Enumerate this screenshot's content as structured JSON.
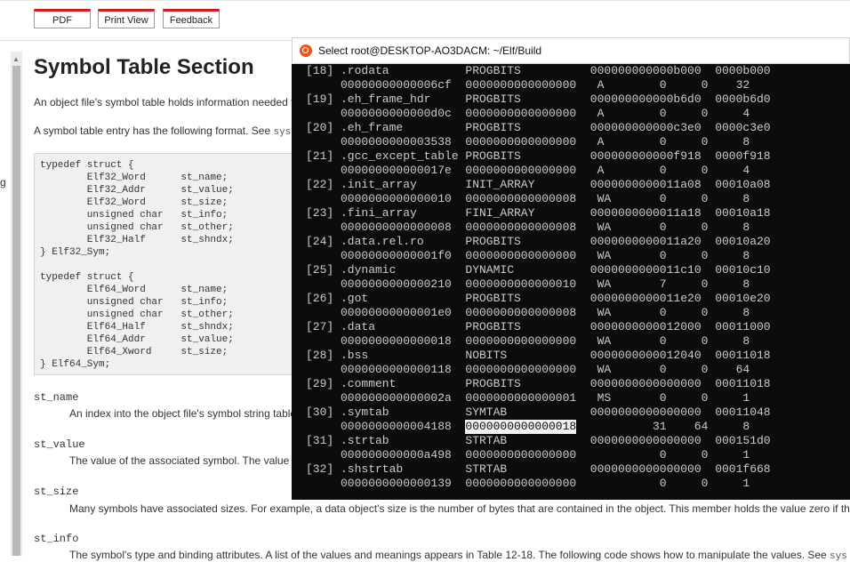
{
  "toolbar": {
    "pdf": "PDF",
    "print_view": "Print View",
    "feedback": "Feedback"
  },
  "left_mark": "g",
  "doc": {
    "title": "Symbol Table Section",
    "para1": "An object file's symbol table holds information needed t",
    "para2_prefix": "A symbol table entry has the following format. See ",
    "para2_code": "sys",
    "code32": "typedef struct {\n        Elf32_Word      st_name;\n        Elf32_Addr      st_value;\n        Elf32_Word      st_size;\n        unsigned char   st_info;\n        unsigned char   st_other;\n        Elf32_Half      st_shndx;\n} Elf32_Sym;",
    "code64": "typedef struct {\n        Elf64_Word      st_name;\n        unsigned char   st_info;\n        unsigned char   st_other;\n        Elf64_Half      st_shndx;\n        Elf64_Addr      st_value;\n        Elf64_Xword     st_size;\n} Elf64_Sym;",
    "terms": [
      {
        "name": "st_name",
        "desc": "An index into the object file's symbol string table"
      },
      {
        "name": "st_value",
        "desc": "The value of the associated symbol. The value"
      },
      {
        "name": "st_size",
        "desc": "Many symbols have associated sizes. For example, a data object's size is the number of bytes that are contained in the object. This member holds the value zero if th"
      },
      {
        "name": "st_info",
        "desc": "The symbol's type and binding attributes. A list of the values and meanings appears in Table 12-18. The following code shows how to manipulate the values. See ",
        "desc_code": "sys"
      }
    ]
  },
  "terminal": {
    "title": "Select root@DESKTOP-AO3DACM: ~/Elf/Build",
    "sections": [
      {
        "idx": "[18]",
        "name": ".rodata",
        "type": "PROGBITS",
        "addr": "000000000000b000",
        "off": "0000b000",
        "size": "00000000000006cf",
        "entsize": "0000000000000000",
        "flags": "A",
        "link": "0",
        "info": "0",
        "align": "32"
      },
      {
        "idx": "[19]",
        "name": ".eh_frame_hdr",
        "type": "PROGBITS",
        "addr": "000000000000b6d0",
        "off": "0000b6d0",
        "size": "0000000000000d0c",
        "entsize": "0000000000000000",
        "flags": "A",
        "link": "0",
        "info": "0",
        "align": "4"
      },
      {
        "idx": "[20]",
        "name": ".eh_frame",
        "type": "PROGBITS",
        "addr": "000000000000c3e0",
        "off": "0000c3e0",
        "size": "0000000000003538",
        "entsize": "0000000000000000",
        "flags": "A",
        "link": "0",
        "info": "0",
        "align": "8"
      },
      {
        "idx": "[21]",
        "name": ".gcc_except_table",
        "type": "PROGBITS",
        "addr": "000000000000f918",
        "off": "0000f918",
        "size": "000000000000017e",
        "entsize": "0000000000000000",
        "flags": "A",
        "link": "0",
        "info": "0",
        "align": "4"
      },
      {
        "idx": "[22]",
        "name": ".init_array",
        "type": "INIT_ARRAY",
        "addr": "0000000000011a08",
        "off": "00010a08",
        "size": "0000000000000010",
        "entsize": "0000000000000008",
        "flags": "WA",
        "link": "0",
        "info": "0",
        "align": "8"
      },
      {
        "idx": "[23]",
        "name": ".fini_array",
        "type": "FINI_ARRAY",
        "addr": "0000000000011a18",
        "off": "00010a18",
        "size": "0000000000000008",
        "entsize": "0000000000000008",
        "flags": "WA",
        "link": "0",
        "info": "0",
        "align": "8"
      },
      {
        "idx": "[24]",
        "name": ".data.rel.ro",
        "type": "PROGBITS",
        "addr": "0000000000011a20",
        "off": "00010a20",
        "size": "00000000000001f0",
        "entsize": "0000000000000000",
        "flags": "WA",
        "link": "0",
        "info": "0",
        "align": "8"
      },
      {
        "idx": "[25]",
        "name": ".dynamic",
        "type": "DYNAMIC",
        "addr": "0000000000011c10",
        "off": "00010c10",
        "size": "0000000000000210",
        "entsize": "0000000000000010",
        "flags": "WA",
        "link": "7",
        "info": "0",
        "align": "8"
      },
      {
        "idx": "[26]",
        "name": ".got",
        "type": "PROGBITS",
        "addr": "0000000000011e20",
        "off": "00010e20",
        "size": "00000000000001e0",
        "entsize": "0000000000000008",
        "flags": "WA",
        "link": "0",
        "info": "0",
        "align": "8"
      },
      {
        "idx": "[27]",
        "name": ".data",
        "type": "PROGBITS",
        "addr": "0000000000012000",
        "off": "00011000",
        "size": "0000000000000018",
        "entsize": "0000000000000000",
        "flags": "WA",
        "link": "0",
        "info": "0",
        "align": "8"
      },
      {
        "idx": "[28]",
        "name": ".bss",
        "type": "NOBITS",
        "addr": "0000000000012040",
        "off": "00011018",
        "size": "0000000000000118",
        "entsize": "0000000000000000",
        "flags": "WA",
        "link": "0",
        "info": "0",
        "align": "64"
      },
      {
        "idx": "[29]",
        "name": ".comment",
        "type": "PROGBITS",
        "addr": "0000000000000000",
        "off": "00011018",
        "size": "000000000000002a",
        "entsize": "0000000000000001",
        "flags": "MS",
        "link": "0",
        "info": "0",
        "align": "1"
      },
      {
        "idx": "[30]",
        "name": ".symtab",
        "type": "SYMTAB",
        "addr": "0000000000000000",
        "off": "00011048",
        "size": "0000000000004188",
        "entsize": "0000000000000018",
        "flags": "",
        "link": "31",
        "info": "64",
        "align": "8",
        "selected": true
      },
      {
        "idx": "[31]",
        "name": ".strtab",
        "type": "STRTAB",
        "addr": "0000000000000000",
        "off": "000151d0",
        "size": "000000000000a498",
        "entsize": "0000000000000000",
        "flags": "",
        "link": "0",
        "info": "0",
        "align": "1"
      },
      {
        "idx": "[32]",
        "name": ".shstrtab",
        "type": "STRTAB",
        "addr": "0000000000000000",
        "off": "0001f668",
        "size": "0000000000000139",
        "entsize": "0000000000000000",
        "flags": "",
        "link": "0",
        "info": "0",
        "align": "1"
      }
    ]
  }
}
